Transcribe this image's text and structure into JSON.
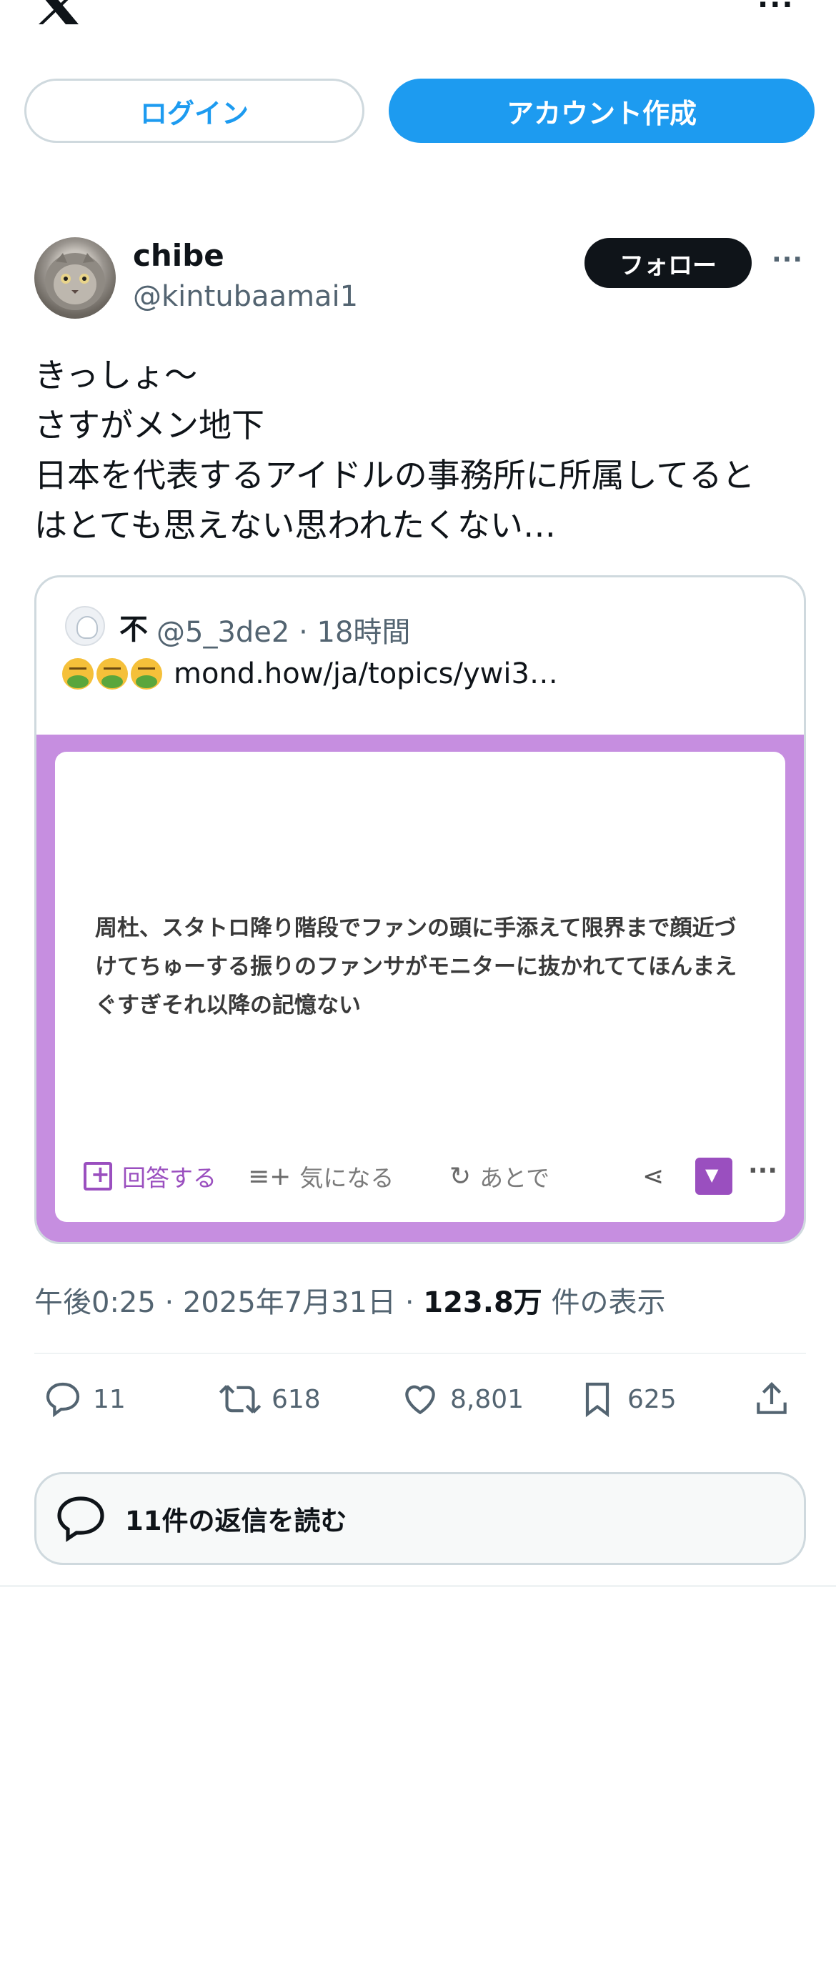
{
  "header": {
    "login_label": "ログイン",
    "signup_label": "アカウント作成",
    "more_label": "···"
  },
  "author": {
    "name": "chibe",
    "handle": "@kintubaamai1",
    "follow_label": "フォロー",
    "more_label": "···"
  },
  "tweet": {
    "text": "きっしょ〜\nさすがメン地下\n日本を代表するアイドルの事務所に所属してると\nはとても思えない思われたくない…",
    "timestamp": "午後0:25 · 2025年7月31日 · ",
    "views_count": "123.8万",
    "views_label": " 件の表示"
  },
  "quote": {
    "name": "不",
    "meta": "@5_3de2 · 18時間",
    "link_text": "mond.how/ja/topics/ywi3…",
    "emoji_count": 3,
    "image": {
      "text": "周杜、スタトロ降り階段でファンの頭に手添えて限界まで顔近づけてちゅーする振りのファンサがモニターに抜かれててほんまえぐすぎそれ以降の記憶ない",
      "answer_label": "回答する",
      "interest_label": "気になる",
      "later_label": "あとで",
      "accent_color": "#c68ee0"
    }
  },
  "actions": {
    "replies": "11",
    "retweets": "618",
    "likes": "8,801",
    "bookmarks": "625"
  },
  "read_replies_label": "11件の返信を読む",
  "colors": {
    "brand": "#1d9bf0",
    "text": "#0f1419",
    "muted": "#536471"
  }
}
